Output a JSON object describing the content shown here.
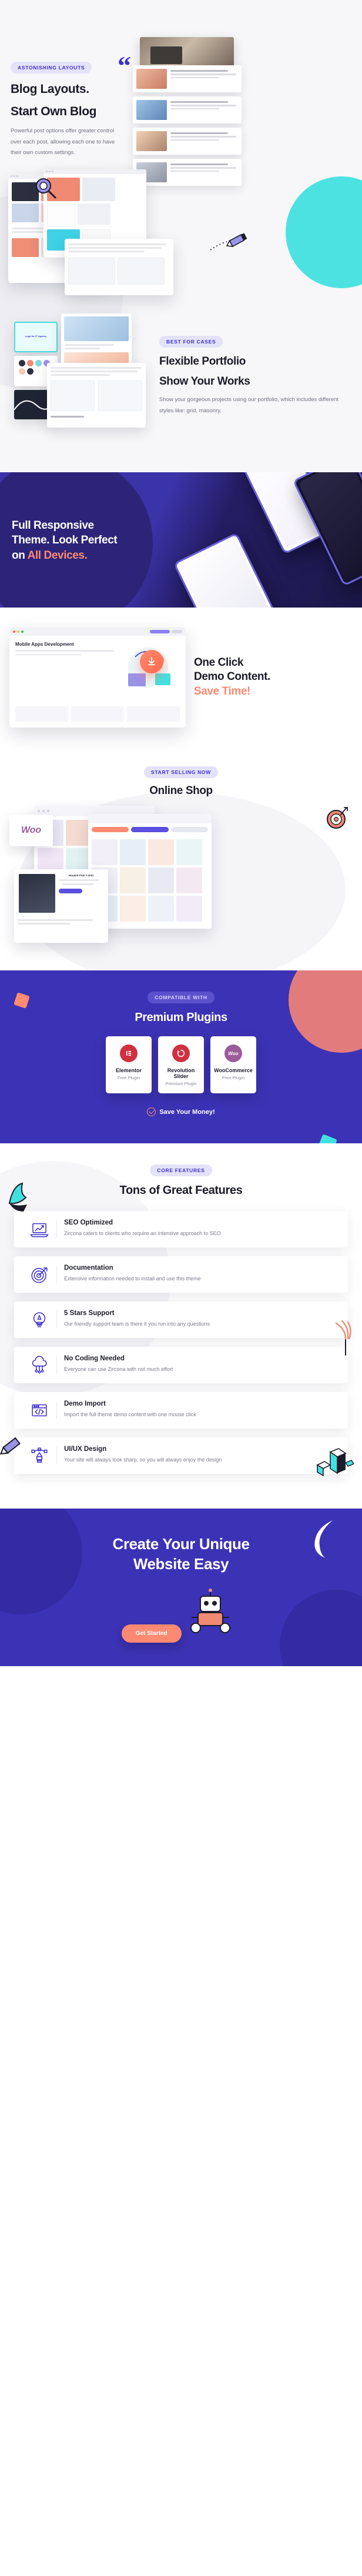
{
  "blog": {
    "badge": "ASTONISHING LAYOUTS",
    "title_line1": "Blog Layouts.",
    "title_line2": "Start Own Blog",
    "description": "Powerful post options offer greater control over each post, allowing each one to have their own custom settings.",
    "quote_glyph": "“"
  },
  "portfolio": {
    "badge": "BEST FOR CASES",
    "title_line1": "Flexible Portfolio",
    "title_line2": "Show Your Works",
    "description": "Show your gorgeous projects using our portfolio, which includes different styles like: grid, masonry.",
    "card_label": "Logo for IT Agency"
  },
  "responsive": {
    "title_line1": "Full Responsive",
    "title_line2": "Theme. Look Perfect",
    "title_line3_prefix": "on ",
    "title_line3_accent": "All Devices."
  },
  "demo": {
    "title_line1": "One Click",
    "title_line2": "Demo Content.",
    "title_accent": "Save Time!",
    "browser_heading": "Mobile Apps Development",
    "download_icon": "download-icon"
  },
  "shop": {
    "badge": "START SELLING NOW",
    "title": "Online Shop",
    "woo_logo": "Woo",
    "product_label": "Hooded Pink T-shirt",
    "target_icon": "target-icon"
  },
  "plugins": {
    "badge": "COMPATIBLE WITH",
    "title": "Premium Plugins",
    "items": [
      {
        "name": "Elementor",
        "type": "Free Plugin",
        "icon": "elementor-icon",
        "color": "#d0303f"
      },
      {
        "name": "Revolution Slider",
        "type": "Premium Plugin",
        "icon": "revolution-slider-icon",
        "color": "#d0303f"
      },
      {
        "name": "WooCommerce",
        "type": "Free Plugin",
        "icon": "woocommerce-icon",
        "color": "#9b5c9b"
      }
    ],
    "save_text": "Save Your Money!",
    "check_icon": "check-circle-icon"
  },
  "features": {
    "badge": "CORE FEATURES",
    "title": "Tons of Great Features",
    "items": [
      {
        "title": "SEO Optimized",
        "desc": "Zircona caters to clients who require an intensive approach to SEO",
        "icon": "laptop-chart-icon"
      },
      {
        "title": "Documentation",
        "desc": "Extensive information needed to install and use this theme",
        "icon": "target-icon"
      },
      {
        "title": "5 Stars Support",
        "desc": "Our friendly support team is there if  you run into any questions",
        "icon": "lightbulb-icon"
      },
      {
        "title": "No Coding Needed",
        "desc": "Everyone can use Zircona with not much effort",
        "icon": "cloud-network-icon"
      },
      {
        "title": "Demo Import",
        "desc": "Import the full theme demo content with one mouse click",
        "icon": "code-window-icon"
      },
      {
        "title": "UI/UX Design",
        "desc": "Your site will always look sharp, so you will always enjoy the design",
        "icon": "pen-tool-icon"
      }
    ]
  },
  "cta": {
    "title_line1": "Create Your Unique",
    "title_line2": "Website Easy",
    "button_label": "Get Started",
    "mascot": "robot-mascot"
  },
  "colors": {
    "brand_purple": "#3c32b5",
    "accent_coral": "#fc8a72",
    "accent_teal": "#43e0e0",
    "badge_bg": "#e4e2f8",
    "badge_text": "#3b2fd0",
    "text_dark": "#1b1b29",
    "text_muted": "#7b7c8c"
  }
}
